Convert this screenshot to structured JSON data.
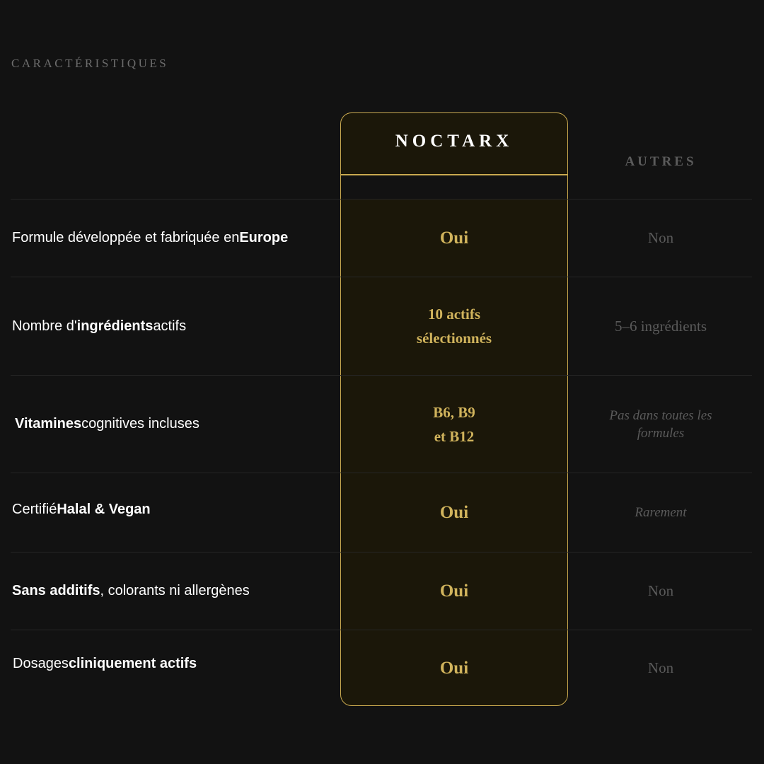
{
  "section_title": "CARACTÉRISTIQUES",
  "columns": {
    "brand": "NOCTARX",
    "others": "AUTRES"
  },
  "rows": [
    {
      "label": [
        {
          "text": "Formule développée et fabriquée en ",
          "bold": false
        },
        {
          "text": "Europe",
          "bold": true
        }
      ],
      "brand_value": [
        "Oui"
      ],
      "other_value": [
        "Non"
      ]
    },
    {
      "label": [
        {
          "text": "Nombre d'",
          "bold": false
        },
        {
          "text": "ingrédients",
          "bold": true
        },
        {
          "text": " actifs",
          "bold": false
        }
      ],
      "brand_value": [
        "10 actifs",
        "sélectionnés"
      ],
      "other_value": [
        "5–6 ingrédients"
      ]
    },
    {
      "label": [
        {
          "text": "Vitamines",
          "bold": true
        },
        {
          "text": " cognitives incluses",
          "bold": false
        }
      ],
      "brand_value": [
        "B6, B9",
        "et B12"
      ],
      "other_value": [
        "Pas dans toutes les",
        "formules"
      ]
    },
    {
      "label": [
        {
          "text": "Certifié ",
          "bold": false
        },
        {
          "text": "Halal & Vegan",
          "bold": true
        }
      ],
      "brand_value": [
        "Oui"
      ],
      "other_value": [
        "Rarement"
      ]
    },
    {
      "label": [
        {
          "text": "Sans additifs",
          "bold": true
        },
        {
          "text": ", colorants ni allergènes",
          "bold": false
        }
      ],
      "brand_value": [
        "Oui"
      ],
      "other_value": [
        "Non"
      ]
    },
    {
      "label": [
        {
          "text": "Dosages ",
          "bold": false
        },
        {
          "text": "cliniquement actifs",
          "bold": true
        }
      ],
      "brand_value": [
        "Oui"
      ],
      "other_value": [
        "Non"
      ]
    }
  ],
  "colors": {
    "background": "#121212",
    "gold": "#c9a94f",
    "gold_text": "#d0b35c",
    "muted": "#5a5a5a"
  }
}
